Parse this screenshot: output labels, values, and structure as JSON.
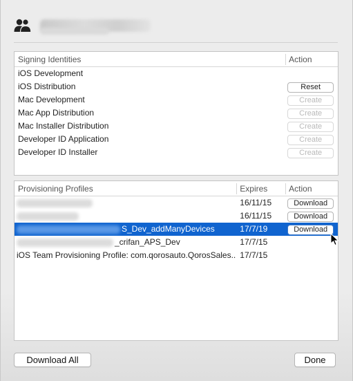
{
  "account": {
    "name": "",
    "sub": ""
  },
  "signing": {
    "header_name": "Signing Identities",
    "header_action": "Action",
    "rows": [
      {
        "name": "iOS Development",
        "button": ""
      },
      {
        "name": "iOS Distribution",
        "button": "Reset"
      },
      {
        "name": "Mac Development",
        "button": "Create"
      },
      {
        "name": "Mac App Distribution",
        "button": "Create"
      },
      {
        "name": "Mac Installer Distribution",
        "button": "Create"
      },
      {
        "name": "Developer ID Application",
        "button": "Create"
      },
      {
        "name": "Developer ID Installer",
        "button": "Create"
      }
    ]
  },
  "profiles": {
    "header_name": "Provisioning Profiles",
    "header_expires": "Expires",
    "header_action": "Action",
    "rows": [
      {
        "name_visible": "",
        "expires": "16/11/15",
        "button": "Download",
        "selected": false
      },
      {
        "name_visible": "",
        "expires": "16/11/15",
        "button": "Download",
        "selected": false
      },
      {
        "name_visible": "S_Dev_addManyDevices",
        "expires": "17/7/19",
        "button": "Download",
        "selected": true
      },
      {
        "name_visible": "_crifan_APS_Dev",
        "expires": "17/7/15",
        "button": "",
        "selected": false
      },
      {
        "name_visible": "iOS Team Provisioning Profile: com.qorosauto.QorosSales...",
        "expires": "17/7/15",
        "button": "",
        "selected": false
      }
    ]
  },
  "footer": {
    "download_all": "Download All",
    "done": "Done"
  },
  "colors": {
    "selection": "#1064cf",
    "background": "#ececec"
  }
}
